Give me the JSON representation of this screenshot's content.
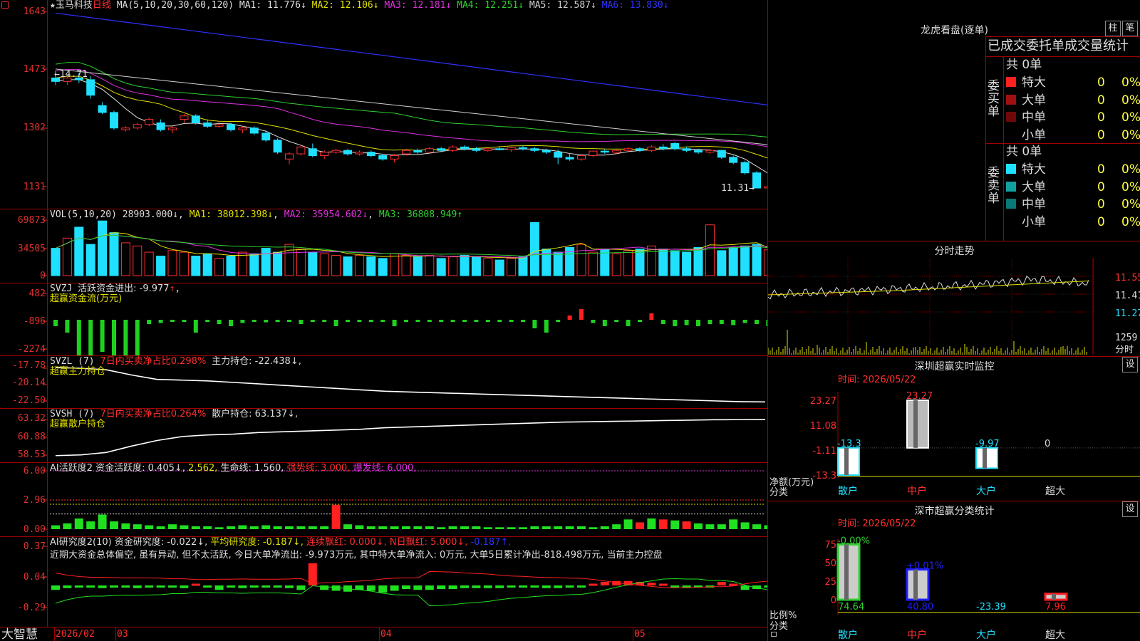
{
  "stock": {
    "star": "★",
    "name": "玉马科技",
    "period": "日线",
    "ma_params": "MA(5,10,20,30,60,120)",
    "ma": [
      {
        "label": "MA1: 11.776",
        "arrow": "↓",
        "color": "#e0e0e0"
      },
      {
        "label": "MA2: 12.106",
        "arrow": "↓",
        "color": "#e0e000"
      },
      {
        "label": "MA3: 12.181",
        "arrow": "↓",
        "color": "#e030e0"
      },
      {
        "label": "MA4: 12.251",
        "arrow": "↓",
        "color": "#30d030"
      },
      {
        "label": "MA5: 12.587",
        "arrow": "↓",
        "color": "#d0d0d0"
      },
      {
        "label": "MA6: 13.830",
        "arrow": "↓",
        "color": "#3030ff"
      }
    ],
    "y_ticks": [
      "1643",
      "1473",
      "1302",
      "1131"
    ],
    "last_label": "11.31→",
    "prior_label": "←14.71"
  },
  "vol": {
    "header": "VOL(5,10,20)",
    "value": "28903.000↓",
    "ma1": "MA1: 38012.398↓",
    "ma2": "MA2: 35954.602↓",
    "ma3": "MA3: 36808.949↑",
    "y_ticks": [
      "69873",
      "34505",
      "0"
    ]
  },
  "svzj": {
    "header": "SVZJ",
    "label": "活跃资金进出: -9.977",
    "arrow": "↑",
    "subtitle": "超赢资金流(万元)",
    "y_ticks": [
      "482",
      "-896",
      "-2274"
    ]
  },
  "svzl": {
    "header": "SVZL (7)",
    "ratio": "7日内买卖净占比0.298%",
    "holding": "主力持仓: -22.438↓,",
    "subtitle": "超赢主力持仓",
    "y_ticks": [
      "-17.78",
      "-20.14",
      "-22.50"
    ]
  },
  "svsh": {
    "header": "SVSH (7)",
    "ratio": "7日内买卖净占比0.264%",
    "holding": "散户持仓: 63.137↓,",
    "subtitle": "超赢散户持仓",
    "y_ticks": [
      "63.32",
      "60.88",
      "58.53"
    ]
  },
  "ai1": {
    "header": "AI活跃度2",
    "a": "资金活跃度: 0.405↓,",
    "b": "2.562,",
    "c": "生命线: 1.560,",
    "d": "强势线: 3.000,",
    "e": "爆发线: 6.000,",
    "y_ticks": [
      "6.00",
      "2.96",
      "0.00"
    ]
  },
  "ai2": {
    "header": "AI研究度2(10)",
    "a": "资金研究度: -0.022↓,",
    "b": "平均研究度: -0.187↓,",
    "c": "连续飘红: 0.000↓,",
    "d": "N日飘红: 5.000↓,",
    "e": "-0.187↑,",
    "comment": "近期大资金总体偏空, 虽有异动, 但不太活跃, 今日大单净流出: -9.973万元, 其中特大单净流入: 0万元, 大单5日累计净出-818.498万元, 当前主力控盘",
    "y_ticks": [
      "0.37",
      "0.04",
      "-0.29"
    ]
  },
  "bottom": {
    "brand": "大智慧",
    "dates": [
      "2026/02",
      "03",
      "04",
      "05"
    ]
  },
  "chart_data": [
    {
      "type": "candlestick",
      "title": "玉马科技 日线",
      "y_ticks": [
        "1643",
        "1473",
        "1302",
        "1131"
      ],
      "ohlc": [
        [
          14.5,
          14.71,
          14.3,
          14.4
        ],
        [
          14.4,
          14.6,
          14.3,
          14.5
        ],
        [
          14.5,
          14.65,
          14.35,
          14.45
        ],
        [
          14.45,
          14.55,
          13.9,
          14.0
        ],
        [
          13.7,
          13.8,
          13.45,
          13.5
        ],
        [
          13.5,
          13.55,
          13.0,
          13.05
        ],
        [
          13.0,
          13.1,
          12.95,
          13.05
        ],
        [
          13.05,
          13.2,
          13.0,
          13.15
        ],
        [
          13.15,
          13.35,
          13.1,
          13.3
        ],
        [
          13.2,
          13.3,
          12.95,
          13.0
        ],
        [
          13.0,
          13.1,
          12.9,
          13.05
        ],
        [
          13.3,
          13.45,
          13.2,
          13.4
        ],
        [
          13.4,
          13.45,
          13.15,
          13.2
        ],
        [
          13.2,
          13.3,
          13.05,
          13.1
        ],
        [
          13.1,
          13.25,
          13.05,
          13.15
        ],
        [
          13.15,
          13.2,
          12.95,
          13.0
        ],
        [
          13.0,
          13.1,
          12.9,
          13.05
        ],
        [
          13.05,
          13.1,
          12.85,
          12.9
        ],
        [
          12.9,
          12.95,
          12.65,
          12.7
        ],
        [
          12.7,
          12.75,
          12.3,
          12.35
        ],
        [
          12.15,
          12.35,
          12.0,
          12.3
        ],
        [
          12.3,
          12.55,
          12.25,
          12.5
        ],
        [
          12.45,
          12.6,
          12.2,
          12.25
        ],
        [
          12.25,
          12.4,
          12.15,
          12.35
        ],
        [
          12.35,
          12.45,
          12.3,
          12.4
        ],
        [
          12.4,
          12.45,
          12.25,
          12.3
        ],
        [
          12.3,
          12.4,
          12.25,
          12.35
        ],
        [
          12.35,
          12.4,
          12.2,
          12.25
        ],
        [
          12.25,
          12.3,
          12.1,
          12.15
        ],
        [
          12.15,
          12.3,
          12.05,
          12.25
        ],
        [
          12.3,
          12.45,
          12.25,
          12.4
        ],
        [
          12.4,
          12.45,
          12.3,
          12.35
        ],
        [
          12.35,
          12.5,
          12.3,
          12.45
        ],
        [
          12.45,
          12.5,
          12.35,
          12.4
        ],
        [
          12.4,
          12.55,
          12.35,
          12.5
        ],
        [
          12.5,
          12.55,
          12.4,
          12.45
        ],
        [
          12.45,
          12.5,
          12.35,
          12.4
        ],
        [
          12.4,
          12.45,
          12.35,
          12.45
        ],
        [
          12.45,
          12.5,
          12.4,
          12.42
        ],
        [
          12.42,
          12.5,
          12.35,
          12.48
        ],
        [
          12.48,
          12.55,
          12.4,
          12.45
        ],
        [
          12.45,
          12.5,
          12.35,
          12.4
        ],
        [
          12.4,
          12.45,
          12.3,
          12.35
        ],
        [
          12.35,
          12.42,
          12.0,
          12.2
        ],
        [
          12.2,
          12.3,
          12.1,
          12.15
        ],
        [
          12.15,
          12.3,
          12.1,
          12.25
        ],
        [
          12.25,
          12.4,
          12.2,
          12.38
        ],
        [
          12.38,
          12.45,
          12.3,
          12.35
        ],
        [
          12.35,
          12.42,
          12.3,
          12.4
        ],
        [
          12.4,
          12.5,
          12.35,
          12.45
        ],
        [
          12.45,
          12.5,
          12.35,
          12.4
        ],
        [
          12.4,
          12.55,
          12.35,
          12.5
        ],
        [
          12.5,
          12.58,
          12.4,
          12.45
        ],
        [
          12.6,
          12.65,
          12.4,
          12.45
        ],
        [
          12.45,
          12.5,
          12.35,
          12.4
        ],
        [
          12.4,
          12.45,
          12.3,
          12.35
        ],
        [
          12.35,
          12.45,
          12.3,
          12.4
        ],
        [
          12.4,
          12.42,
          12.15,
          12.2
        ],
        [
          12.2,
          12.25,
          12.0,
          12.05
        ],
        [
          12.05,
          12.1,
          11.7,
          11.75
        ],
        [
          11.75,
          11.8,
          11.3,
          11.31
        ],
        [
          11.31,
          11.4,
          11.25,
          11.35
        ]
      ]
    },
    {
      "type": "bar",
      "title": "VOL(5,10,20)",
      "values": [
        35000,
        48000,
        62000,
        40000,
        70000,
        55000,
        42000,
        38000,
        30000,
        25000,
        32000,
        30000,
        25000,
        28000,
        22000,
        25000,
        30000,
        28000,
        35000,
        30000,
        40000,
        34000,
        30000,
        28000,
        26000,
        24000,
        26000,
        24000,
        22000,
        28000,
        26000,
        24000,
        26000,
        22000,
        24000,
        26000,
        24000,
        22000,
        20000,
        22000,
        24000,
        68000,
        34000,
        30000,
        36000,
        40000,
        30000,
        34000,
        28000,
        32000,
        34000,
        38000,
        34000,
        32000,
        30000,
        36000,
        65000,
        32000,
        36000,
        38000,
        40000,
        33000
      ]
    },
    {
      "type": "bar",
      "title": "超赢资金流(万元)",
      "values": [
        -300,
        -600,
        -1900,
        -2200,
        -1500,
        -1800,
        -2300,
        -1900,
        -200,
        -150,
        -100,
        -80,
        -600,
        -100,
        -200,
        -300,
        -150,
        -100,
        -120,
        -80,
        -50,
        -200,
        -100,
        -80,
        -300,
        -100,
        -50,
        -80,
        -60,
        -300,
        -100,
        -50,
        -80,
        -60,
        -100,
        -50,
        -80,
        -60,
        -100,
        -80,
        -50,
        -400,
        -600,
        -30,
        200,
        500,
        -150,
        -300,
        -100,
        -300,
        -50,
        300,
        -200,
        -300,
        -250,
        -300,
        -200,
        -200,
        -250,
        -150,
        -200,
        -300
      ]
    },
    {
      "type": "line",
      "title": "超赢主力持仓",
      "values": [
        -17.8,
        -17.9,
        -18.1,
        -18.8,
        -19.4,
        -19.5,
        -19.6,
        -19.8,
        -20.0,
        -20.2,
        -20.4,
        -20.6,
        -20.8,
        -21.0,
        -21.1,
        -21.2,
        -21.3,
        -21.4,
        -21.5,
        -21.6,
        -21.7,
        -21.8,
        -21.9,
        -22.0,
        -22.1,
        -22.2,
        -22.3,
        -22.4,
        -22.44
      ]
    },
    {
      "type": "line",
      "title": "超赢散户持仓",
      "values": [
        58.6,
        58.7,
        59.0,
        59.8,
        60.5,
        61.0,
        61.2,
        61.3,
        61.5,
        61.6,
        61.7,
        61.8,
        61.9,
        62.1,
        62.2,
        62.3,
        62.4,
        62.5,
        62.6,
        62.7,
        62.8,
        62.85,
        62.9,
        62.95,
        63.0,
        63.05,
        63.1,
        63.12,
        63.137
      ]
    },
    {
      "type": "bar",
      "title": "AI活跃度2",
      "values": [
        0.4,
        0.6,
        1.1,
        0.8,
        1.5,
        0.8,
        0.6,
        0.5,
        0.4,
        0.3,
        0.5,
        0.4,
        0.3,
        0.3,
        0.2,
        0.3,
        0.4,
        0.3,
        0.4,
        0.3,
        0.3,
        0.3,
        0.3,
        0.3,
        2.5,
        0.5,
        0.4,
        0.3,
        0.3,
        0.3,
        0.3,
        0.3,
        0.3,
        0.2,
        0.3,
        0.3,
        0.3,
        0.2,
        0.2,
        0.2,
        0.2,
        0.3,
        0.3,
        0.3,
        0.3,
        0.3,
        0.2,
        0.3,
        0.5,
        1.0,
        0.7,
        1.1,
        1.0,
        0.9,
        0.8,
        0.6,
        0.5,
        0.5,
        1.0,
        0.7,
        0.5,
        0.405
      ]
    },
    {
      "type": "bar",
      "title": "AI研究度2(10)",
      "values": [
        -0.05,
        -0.03,
        -0.02,
        -0.02,
        -0.03,
        -0.02,
        -0.02,
        -0.03,
        -0.02,
        -0.02,
        -0.02,
        -0.03,
        0.02,
        -0.02,
        -0.05,
        -0.02,
        -0.03,
        -0.02,
        -0.02,
        -0.02,
        -0.03,
        -0.05,
        0.25,
        -0.05,
        -0.06,
        -0.07,
        -0.05,
        -0.06,
        -0.08,
        -0.06,
        -0.04,
        -0.05,
        -0.05,
        -0.04,
        -0.04,
        -0.03,
        -0.03,
        -0.03,
        -0.03,
        -0.02,
        -0.02,
        -0.02,
        -0.03,
        -0.03,
        -0.02,
        -0.02,
        0.02,
        0.04,
        0.05,
        0.05,
        0.04,
        0.03,
        0.02,
        -0.02,
        -0.03,
        -0.02,
        -0.02,
        0.04,
        0.02,
        -0.05,
        -0.04,
        -0.022
      ]
    }
  ],
  "right": {
    "dragon_title": "龙虎看盘(逐单)",
    "btn1": "柱",
    "btn2": "笔",
    "section_title": "已成交委托单成交量统计",
    "buy_title": "共 0单",
    "buy_label": "委买单",
    "sell_title": "共 0单",
    "sell_label": "委卖单",
    "buy_rows": [
      {
        "name": "特大",
        "count": "0",
        "pct": "0%",
        "color": "#ff2020"
      },
      {
        "name": "大单",
        "count": "0",
        "pct": "0%",
        "color": "#a01010"
      },
      {
        "name": "中单",
        "count": "0",
        "pct": "0%",
        "color": "#700808"
      },
      {
        "name": "小单",
        "count": "0",
        "pct": "0%",
        "color": ""
      }
    ],
    "sell_rows": [
      {
        "name": "特大",
        "count": "0",
        "pct": "0%",
        "color": "#20e0ff"
      },
      {
        "name": "大单",
        "count": "0",
        "pct": "0%",
        "color": "#10a0a0"
      },
      {
        "name": "中单",
        "count": "0",
        "pct": "0%",
        "color": "#087878"
      },
      {
        "name": "小单",
        "count": "0",
        "pct": "0%",
        "color": ""
      }
    ],
    "intraday_title": "分时走势",
    "intraday_prices": [
      "11.55",
      "11.41",
      "11.27"
    ],
    "intraday_vol": "1259",
    "intraday_tag": "分时",
    "sz_title": "深圳超赢实时监控",
    "sz_btn": "设",
    "sz_time": "时间: 2026/05/22",
    "sz_y": [
      "23.27",
      "11.08",
      "-1.11",
      "-13.3"
    ],
    "sz_labels": [
      "净额(万元)",
      "分类"
    ],
    "sz_bars": [
      {
        "cat": "散户",
        "value": -13.3,
        "label": "-13.3"
      },
      {
        "cat": "中户",
        "value": 23.27,
        "label": "23.27"
      },
      {
        "cat": "大户",
        "value": -9.97,
        "label": "-9.97"
      },
      {
        "cat": "超大",
        "value": 0,
        "label": "0"
      }
    ],
    "sc_title": "深市超赢分类统计",
    "sc_btn": "设",
    "sc_time": "时间: 2026/05/22",
    "sc_y": [
      "75",
      "50",
      "25",
      "0"
    ],
    "sc_labels": [
      "比例%",
      "分类"
    ],
    "sc_bars": [
      {
        "cat": "散户",
        "value": 74.64,
        "top": "-0.00%",
        "bottom": "74.64",
        "color": "#30d030"
      },
      {
        "cat": "中户",
        "value": 40.8,
        "top": "+0.01%",
        "bottom": "40.80",
        "color": "#2020ff"
      },
      {
        "cat": "大户",
        "value": 0,
        "top": "",
        "bottom": "-23.39",
        "color": "#20e0ff"
      },
      {
        "cat": "超大",
        "value": 7.96,
        "top": "",
        "bottom": "7.96",
        "color": "#ff2020"
      }
    ]
  }
}
